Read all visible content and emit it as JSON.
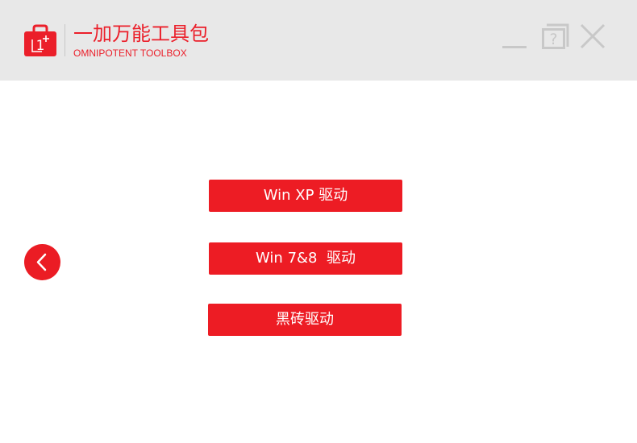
{
  "app": {
    "title_cn": "一加万能工具包",
    "title_en": "OMNIPOTENT TOOLBOX",
    "logo_icon": "oneplus-toolbox-icon",
    "accent_color": "#eb1f2a"
  },
  "window_controls": {
    "minimize_icon": "minimize-icon",
    "help_icon": "help-icon",
    "help_glyph": "?",
    "close_icon": "close-icon",
    "icon_color": "#c8c8c8"
  },
  "navigation": {
    "back_icon": "chevron-left-icon"
  },
  "drivers": {
    "buttons": [
      {
        "label": "Win XP 驱动"
      },
      {
        "label": "Win 7&8  驱动"
      },
      {
        "label": "黑砖驱动"
      }
    ]
  }
}
